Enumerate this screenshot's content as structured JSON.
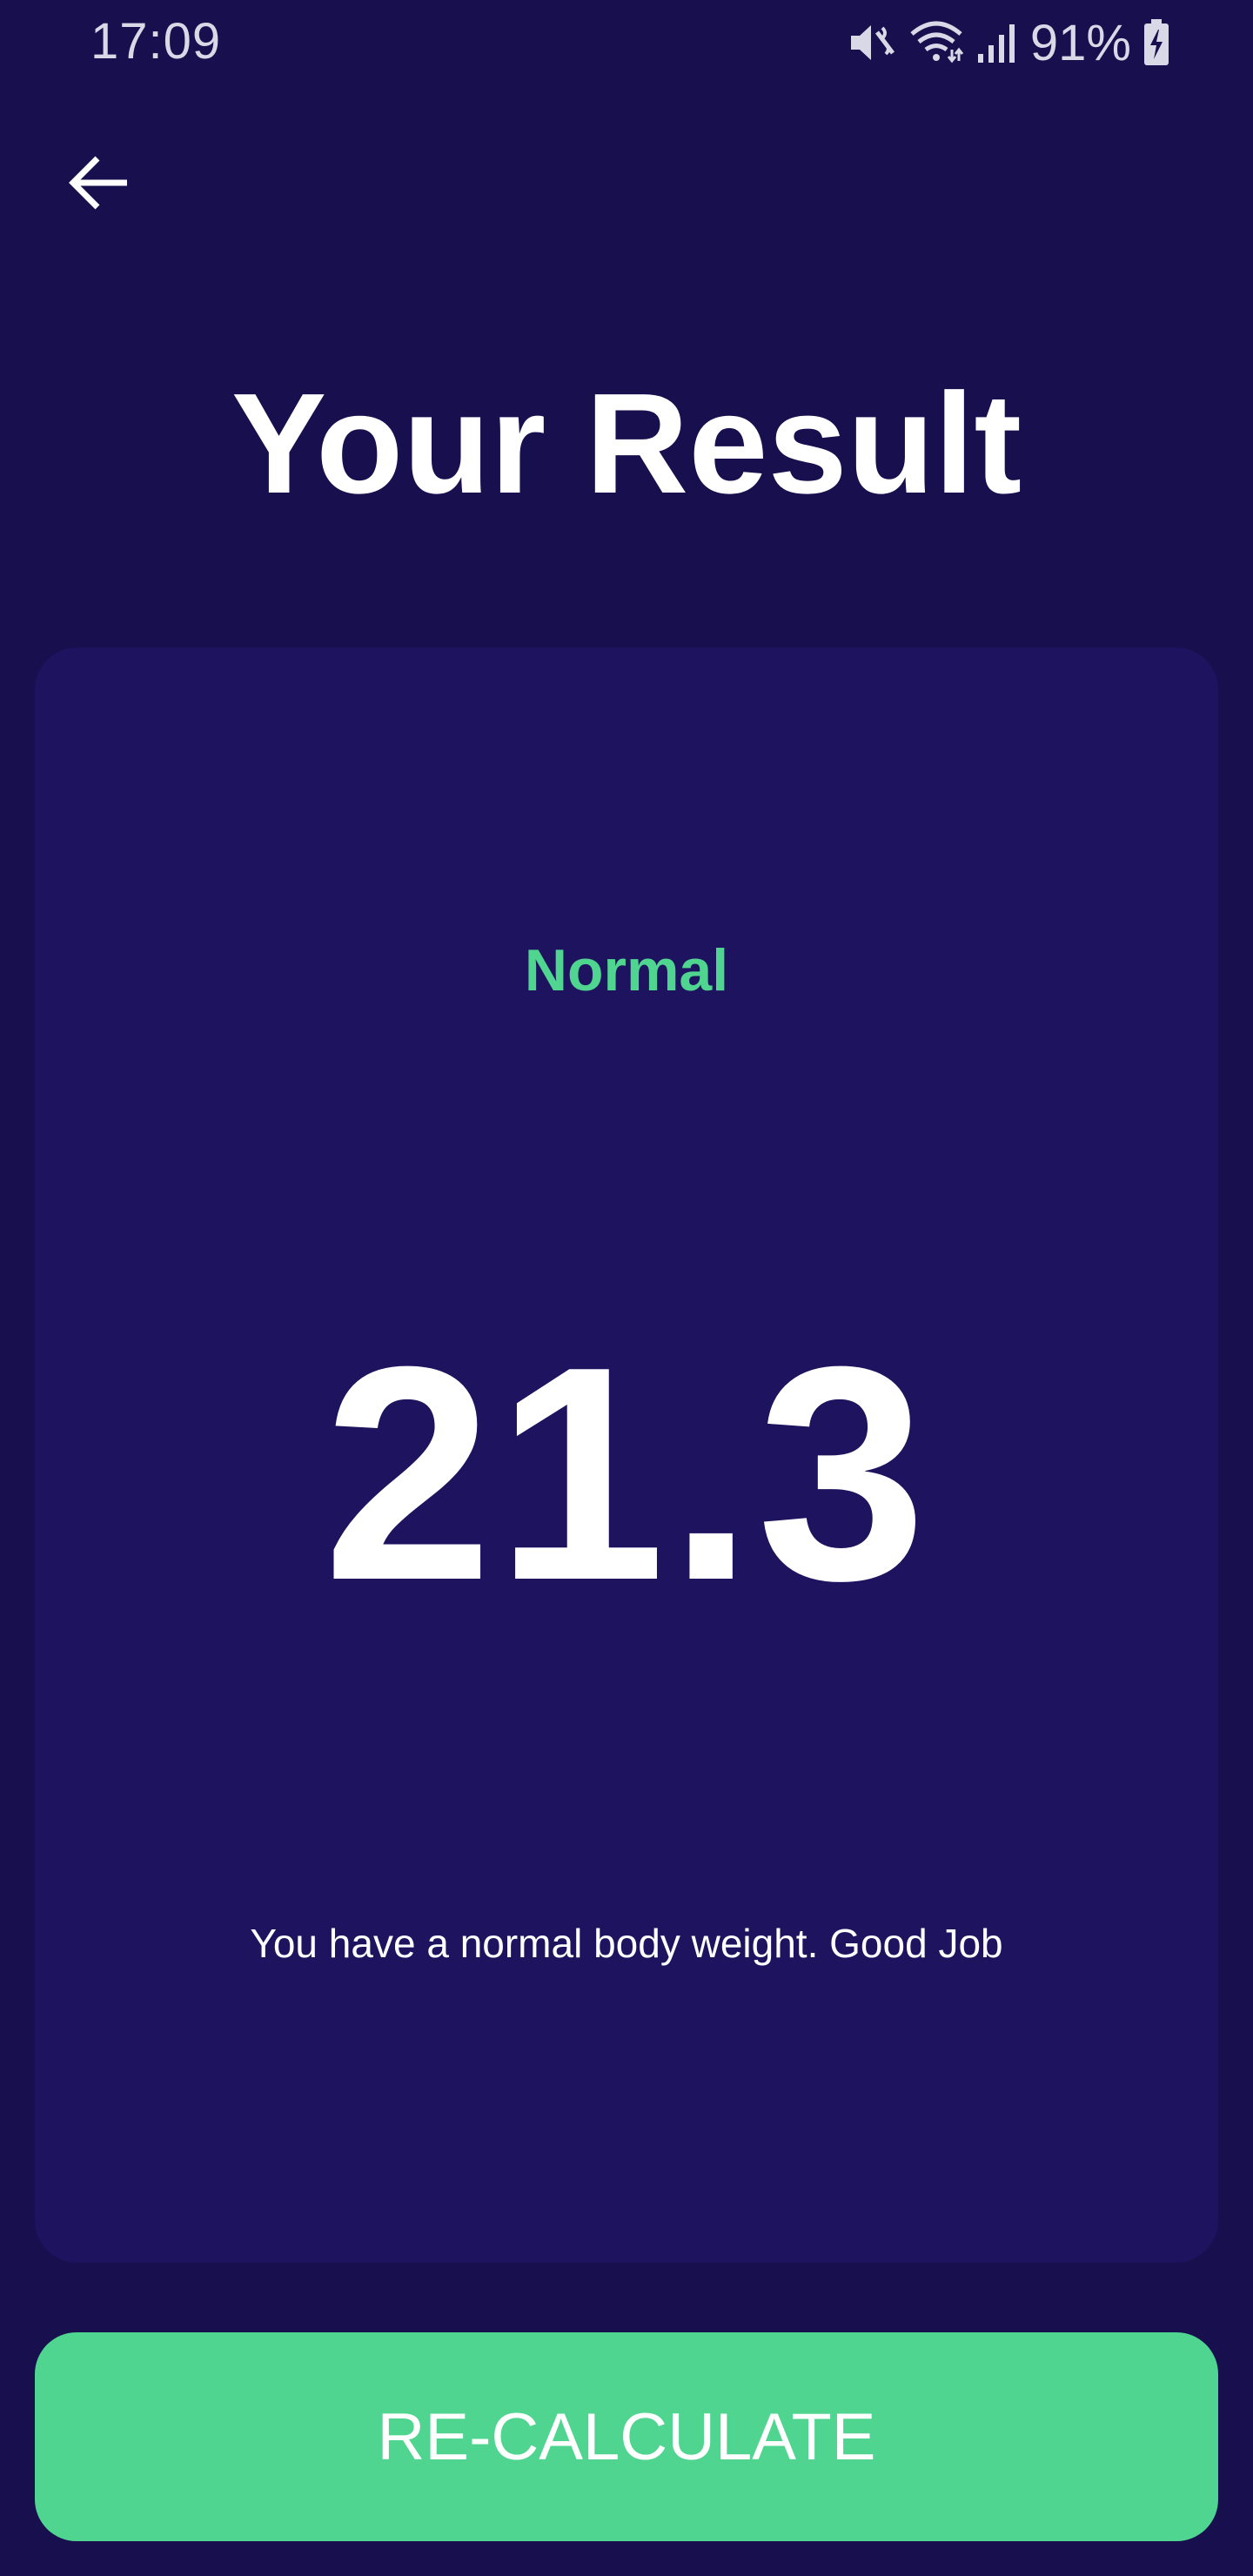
{
  "status_bar": {
    "time": "17:09",
    "battery_percent": "91%",
    "icons": [
      "mute-icon",
      "wifi-icon",
      "signal-icon",
      "battery-charging-icon"
    ]
  },
  "header": {
    "back_icon": "arrow-left-icon",
    "title": "Your Result"
  },
  "result": {
    "category": "Normal",
    "bmi": "21.3",
    "message": "You have a normal body weight. Good Job"
  },
  "actions": {
    "recalculate_label": "RE-CALCULATE"
  },
  "colors": {
    "background": "#170f4e",
    "card": "#1d135f",
    "accent": "#4fd58f",
    "text": "#ffffff"
  }
}
